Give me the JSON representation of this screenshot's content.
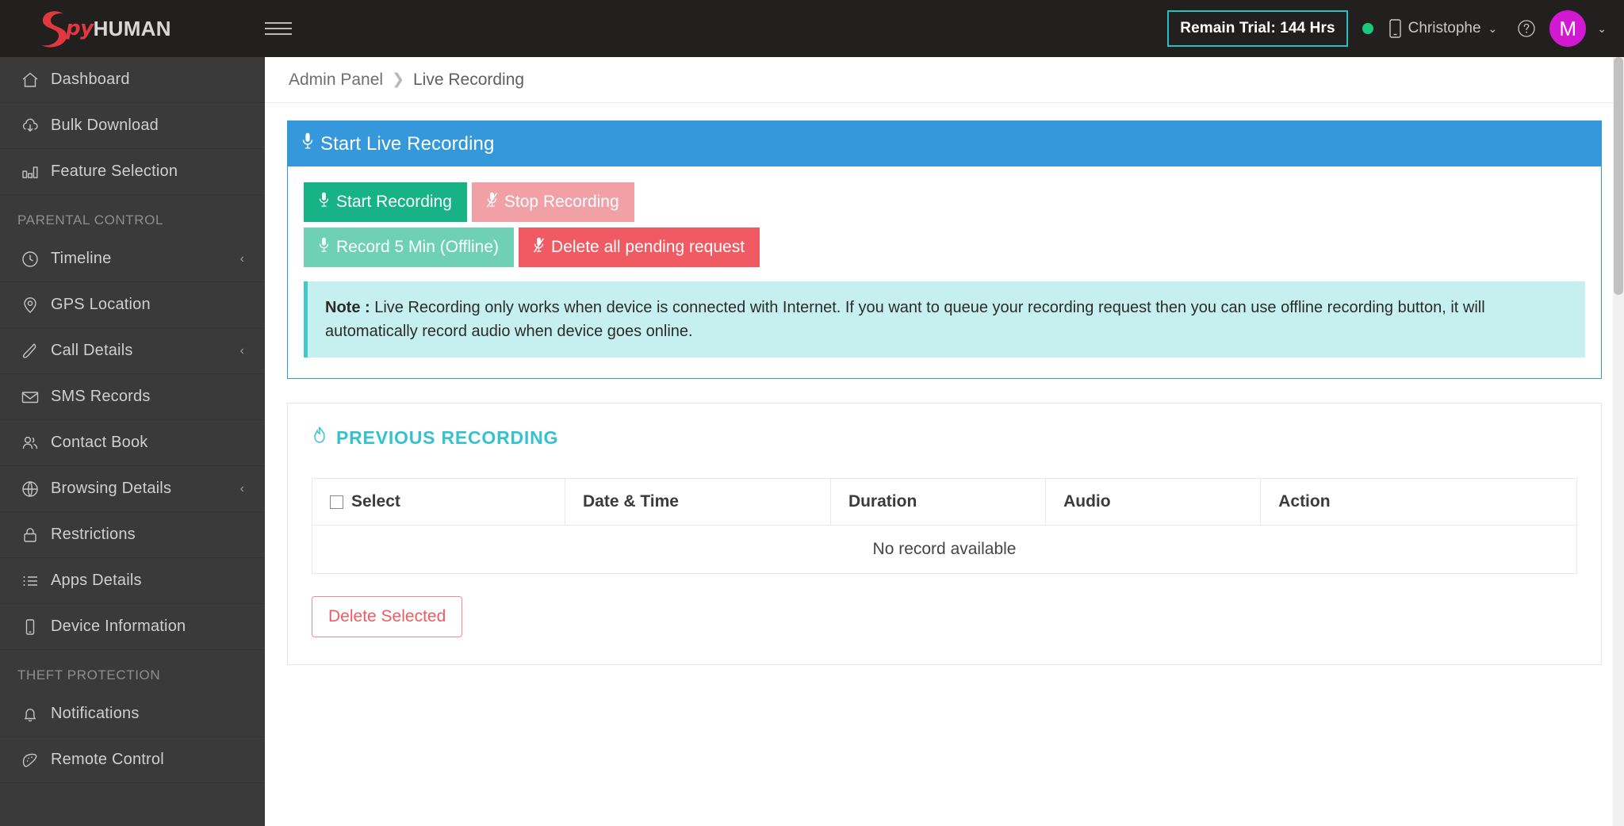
{
  "topbar": {
    "brand_spy": "py",
    "brand_human": "HUMAN",
    "menu_icon": "hamburger-icon",
    "trial_label": "Remain Trial: 144 Hrs",
    "status_dot": "online-status-dot",
    "device_icon": "phone-icon",
    "device_name": "Christophe",
    "device_caret": "⌄",
    "help_icon": "help-circle-icon",
    "avatar_initial": "M",
    "avatar_caret": "⌄",
    "accent_trial_border": "#25c0c6",
    "status_color": "#18c97e",
    "avatar_color": "#d119d1"
  },
  "sidebar": {
    "items": [
      {
        "label": "Dashboard",
        "icon": "home-icon",
        "caret": ""
      },
      {
        "label": "Bulk Download",
        "icon": "cloud-download-icon",
        "caret": ""
      },
      {
        "label": "Feature Selection",
        "icon": "bar-chart-icon",
        "caret": ""
      }
    ],
    "group1_title": "PARENTAL CONTROL",
    "group1_items": [
      {
        "label": "Timeline",
        "icon": "clock-icon",
        "caret": "‹"
      },
      {
        "label": "GPS Location",
        "icon": "map-pin-icon",
        "caret": ""
      },
      {
        "label": "Call Details",
        "icon": "phone-call-icon",
        "caret": "‹"
      },
      {
        "label": "SMS Records",
        "icon": "envelope-icon",
        "caret": ""
      },
      {
        "label": "Contact Book",
        "icon": "contacts-icon",
        "caret": ""
      },
      {
        "label": "Browsing Details",
        "icon": "globe-icon",
        "caret": "‹"
      },
      {
        "label": "Restrictions",
        "icon": "lock-icon",
        "caret": ""
      },
      {
        "label": "Apps Details",
        "icon": "list-icon",
        "caret": ""
      },
      {
        "label": "Device Information",
        "icon": "mobile-icon",
        "caret": ""
      }
    ],
    "group2_title": "THEFT PROTECTION",
    "group2_items": [
      {
        "label": "Notifications",
        "icon": "bell-icon",
        "caret": ""
      },
      {
        "label": "Remote Control",
        "icon": "remote-control-icon",
        "caret": ""
      }
    ]
  },
  "breadcrumb": {
    "root": "Admin Panel",
    "separator": "❯",
    "current": "Live Recording"
  },
  "live_panel": {
    "title": "Start Live Recording",
    "title_icon": "microphone-icon",
    "header_color": "#3498db",
    "buttons": [
      {
        "label": "Start Recording",
        "icon": "microphone-icon",
        "color": "#17b387"
      },
      {
        "label": "Stop Recording",
        "icon": "microphone-slash-icon",
        "color": "#f1a0a6"
      },
      {
        "label": "Record 5 Min (Offline)",
        "icon": "microphone-icon",
        "color": "#6ed0b5"
      },
      {
        "label": "Delete all pending request",
        "icon": "microphone-slash-icon",
        "color": "#ef5a63"
      }
    ],
    "note_label": "Note :",
    "note_text": " Live Recording only works when device is connected with Internet. If you want to queue your recording request then you can use offline recording button, it will automatically record audio when device goes online."
  },
  "previous": {
    "title": "PREVIOUS RECORDING",
    "title_icon": "fire-icon",
    "title_color": "#35c2cf",
    "columns": [
      "Select",
      "Date & Time",
      "Duration",
      "Audio",
      "Action"
    ],
    "select_checkbox": "select-all-checkbox",
    "empty_message": "No record available",
    "delete_button": "Delete Selected"
  }
}
